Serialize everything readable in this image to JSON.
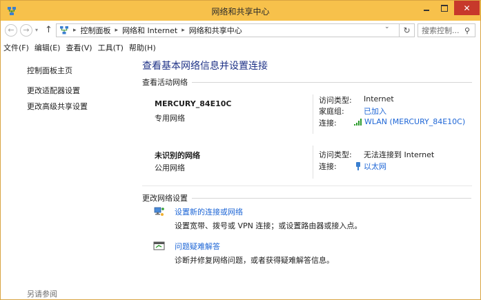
{
  "window": {
    "title": "网络和共享中心"
  },
  "address": {
    "crumbs": [
      "控制面板",
      "网络和 Internet",
      "网络和共享中心"
    ],
    "search_placeholder": "搜索控制...",
    "back_glyph": "←",
    "forward_glyph": "→",
    "up_glyph": "↑",
    "refresh_glyph": "↻",
    "search_glyph": "⚲"
  },
  "menu": [
    "文件(F)",
    "编辑(E)",
    "查看(V)",
    "工具(T)",
    "帮助(H)"
  ],
  "sidebar": {
    "items": [
      "控制面板主页",
      "更改适配器设置",
      "更改高级共享设置"
    ],
    "see_also": "另请参阅"
  },
  "main": {
    "title": "查看基本网络信息并设置连接",
    "active_header": "查看活动网络",
    "networks": [
      {
        "name": "MERCURY_84E10C",
        "type": "专用网络",
        "access_label": "访问类型:",
        "access_value": "Internet",
        "homegroup_label": "家庭组:",
        "homegroup_value": "已加入",
        "conn_label": "连接:",
        "conn_value": "WLAN (MERCURY_84E10C)"
      },
      {
        "name": "未识别的网络",
        "type": "公用网络",
        "access_label": "访问类型:",
        "access_value": "无法连接到 Internet",
        "conn_label": "连接:",
        "conn_value": "以太网"
      }
    ],
    "change_header": "更改网络设置",
    "tasks": [
      {
        "link": "设置新的连接或网络",
        "desc": "设置宽带、拨号或 VPN 连接；或设置路由器或接入点。"
      },
      {
        "link": "问题疑难解答",
        "desc": "诊断并修复网络问题，或者获得疑难解答信息。"
      }
    ]
  },
  "colors": {
    "titlebar": "#f7c14b",
    "close": "#c7392b",
    "link": "#1e66d6",
    "heading": "#1e3287"
  }
}
